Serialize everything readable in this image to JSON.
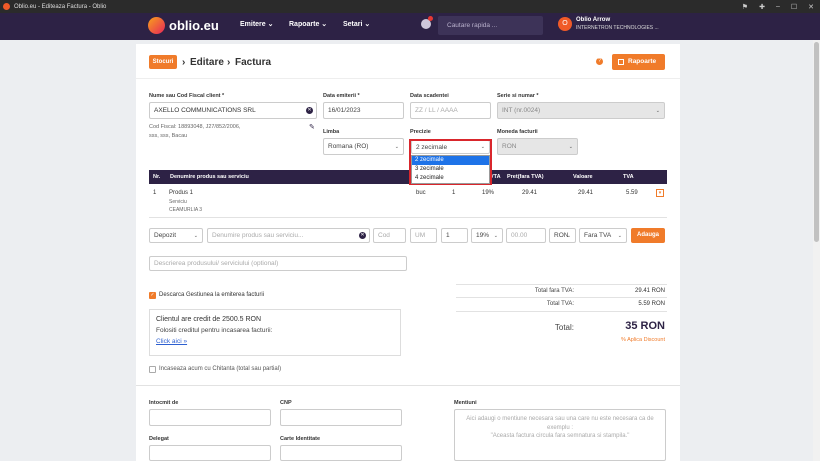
{
  "window": {
    "title": "Oblio.eu - Editeaza Factura - Oblio"
  },
  "nav": {
    "logo": "oblio.eu",
    "links": [
      "Emitere",
      "Rapoarte",
      "Setari"
    ],
    "search_placeholder": "Cautare rapida ...",
    "user_initial": "O",
    "user_name": "Oblio Arrow",
    "user_company": "INTERNETRON TECHNOLOGIES ..."
  },
  "breadcrumb": {
    "badge": "Stocuri",
    "sep": "›",
    "items": [
      "Editare",
      "Factura"
    ]
  },
  "actions": {
    "help": "?",
    "rapoarte": "Rapoarte"
  },
  "form": {
    "client_label": "Nume sau Cod Fiscal client *",
    "client_value": "AXELLO COMMUNICATIONS SRL",
    "client_info": [
      "Cod Fiscal: 18893048, J27/852/2006,",
      "sss, sss, Bacau"
    ],
    "date_label": "Data emiterii *",
    "date_value": "16/01/2023",
    "due_label": "Data scadentei",
    "due_placeholder": "ZZ / LL / AAAA",
    "series_label": "Serie si numar *",
    "series_value": "INT (nr.0024)",
    "language_label": "Limba",
    "language_value": "Romana (RO)",
    "precision_label": "Precizie",
    "precision_value": "2 zecimale",
    "precision_options": [
      "2 zecimale",
      "3 zecimale",
      "4 zecimale"
    ],
    "currency_label": "Moneda facturii",
    "currency_value": "RON"
  },
  "table": {
    "headers": {
      "nr": "Nr.",
      "name": "Denumire produs sau serviciu",
      "vat": "VTA",
      "price": "Pret(fara TVA)",
      "value": "Valoare",
      "tva": "TVA"
    },
    "row": {
      "nr": "1",
      "name": "Produs 1",
      "type": "Serviciu",
      "warehouse": "CEAMURLIA 3",
      "unit": "buc",
      "qty": "1",
      "vat": "19%",
      "price": "29.41",
      "value": "29.41",
      "tva": "5.59"
    }
  },
  "add_row": {
    "type": "Depozit",
    "name_placeholder": "Denumire produs sau serviciu...",
    "code_placeholder": "Cod",
    "um_placeholder": "UM",
    "qty": "1",
    "vat": "19%",
    "price_placeholder": "00.00",
    "currency": "RON",
    "vat_mode": "Fara TVA",
    "add_button": "Adauga",
    "desc_placeholder": "Descrierea produsului/ serviciului (optional)"
  },
  "stock_check": "Descarca Gestiunea la emiterea facturii",
  "credit": {
    "line1": "Clientul are credit de 2500.5 RON",
    "line2": "Folositi creditul pentru incasarea facturii:",
    "link": "Click aici »"
  },
  "totals": {
    "no_vat_label": "Total fara TVA:",
    "no_vat_value": "29.41 RON",
    "vat_label": "Total TVA:",
    "vat_value": "5.59 RON",
    "total_label": "Total:",
    "total_value": "35 RON",
    "discount": "% Aplica Discount"
  },
  "collect_now": "Incaseaza acum cu Chitanta (total sau partial)",
  "footer_fields": {
    "issuer": "Intocmit de",
    "cnp": "CNP",
    "delegate": "Delegat",
    "id_card": "Carte Identitate",
    "mentions": "Mentiuni",
    "mentions_placeholder": "Aici adaugi o mentiune necesara sau una care nu este necesara ca de exemplu :\n\"Aceasta factura circula fara semnatura si stampila.\""
  },
  "colors": {
    "nav": "#2d2245",
    "accent": "#f07b2a",
    "dropdown_highlight": "#d9262c",
    "selected": "#1e73e8"
  }
}
